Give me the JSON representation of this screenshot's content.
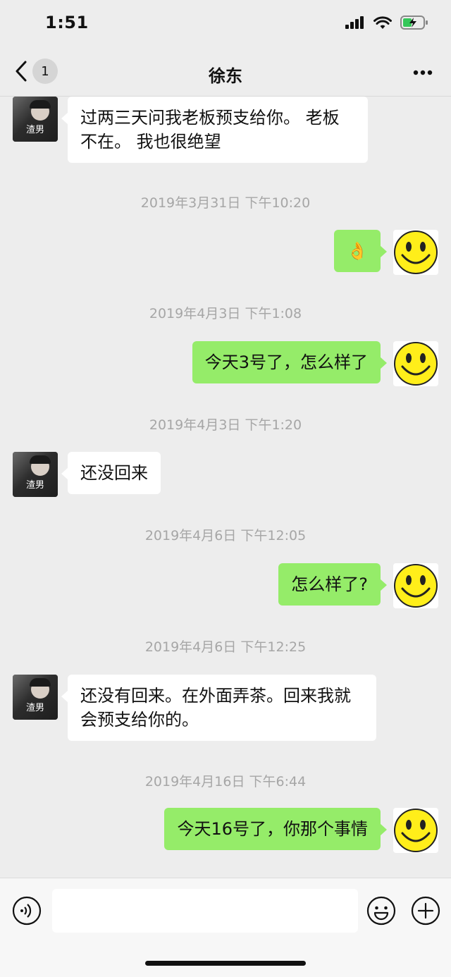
{
  "status_bar": {
    "time": "1:51"
  },
  "header": {
    "back_count": "1",
    "contact_name": "徐东"
  },
  "left_avatar_label": "渣男",
  "messages": {
    "m1": "过两三天问我老板预支给你。 老板不在。 我也很绝望",
    "t1": "2019年3月31日 下午10:20",
    "m2": "👌",
    "t2": "2019年4月3日 下午1:08",
    "m3": "今天3号了，怎么样了",
    "t3": "2019年4月3日 下午1:20",
    "m4": "还没回来",
    "t4": "2019年4月6日 下午12:05",
    "m5": "怎么样了?",
    "t5": "2019年4月6日 下午12:25",
    "m6": "还没有回来。在外面弄茶。回来我就会预支给你的。",
    "t6": "2019年4月16日 下午6:44",
    "m7": "今天16号了，你那个事情"
  },
  "colors": {
    "sent_bubble": "#95ec69",
    "received_bubble": "#ffffff",
    "background": "#ededed"
  },
  "icons": [
    "signal-icon",
    "wifi-icon",
    "battery-charging-icon",
    "back-arrow-icon",
    "more-icon",
    "smiley-avatar-icon",
    "voice-icon",
    "emoji-icon",
    "plus-icon"
  ]
}
